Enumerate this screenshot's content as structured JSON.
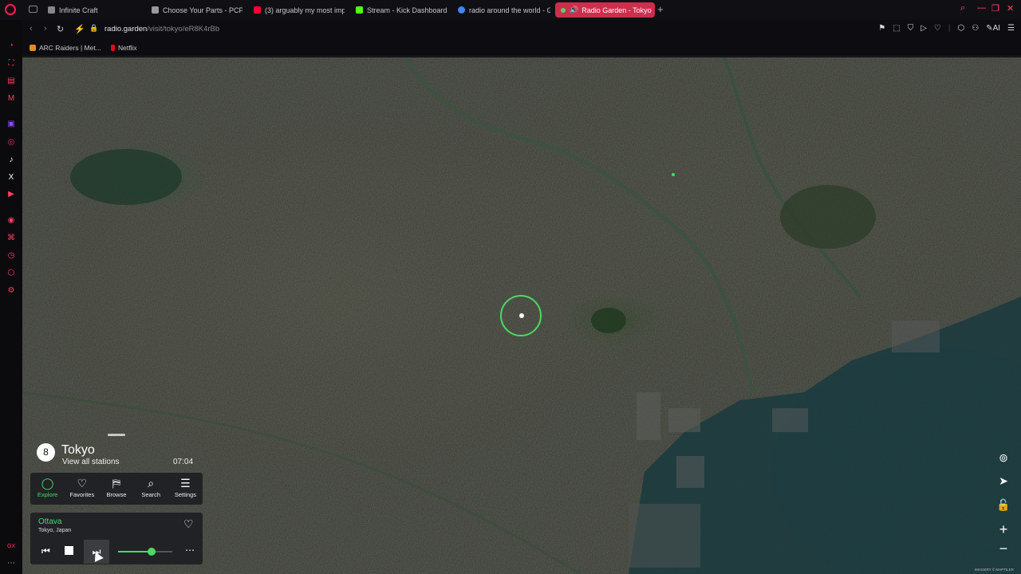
{
  "tabs": [
    {
      "label": "Infinite Craft",
      "color": "#888888"
    },
    {
      "label": "Choose Your Parts - PCPa",
      "color": "#999999"
    },
    {
      "label": "(3) arguably my most imp",
      "color": "#ff0033"
    },
    {
      "label": "Stream - Kick Dashboard",
      "color": "#53fc18"
    },
    {
      "label": "radio around the world - G",
      "color": "#4285f4"
    },
    {
      "label": "Radio Garden - Tokyo",
      "color": "#4cd964",
      "active": true
    }
  ],
  "address": {
    "host": "radio.garden",
    "path": "/visit/tokyo/eR8K4rBb"
  },
  "bookmarks": [
    {
      "label": "ARC Raiders | Met...",
      "color": "#e08a2c"
    },
    {
      "label": "Netflix",
      "color": "#e50914"
    }
  ],
  "sidebar_icons": [
    "messenger-icon",
    "gaming-icon",
    "news-icon",
    "mail-icon",
    "twitch-icon",
    "instagram-icon",
    "tiktok-icon",
    "x-icon",
    "youtube-icon",
    "player-icon",
    "pinboard-icon",
    "history-icon",
    "extensions-icon",
    "settings-icon"
  ],
  "sidebar_bottom": "GX",
  "map": {
    "station_count": "8",
    "place": "Tokyo",
    "view_all": "View all stations",
    "local_time": "07:04",
    "attribution": "IMAGERY © MAPTILER"
  },
  "nav": [
    {
      "label": "Explore",
      "active": true
    },
    {
      "label": "Favorites"
    },
    {
      "label": "Browse"
    },
    {
      "label": "Search"
    },
    {
      "label": "Settings"
    }
  ],
  "player": {
    "station": "Ottava",
    "location": "Tokyo, Japan",
    "volume": 0.62
  },
  "accent": "#4cd964"
}
